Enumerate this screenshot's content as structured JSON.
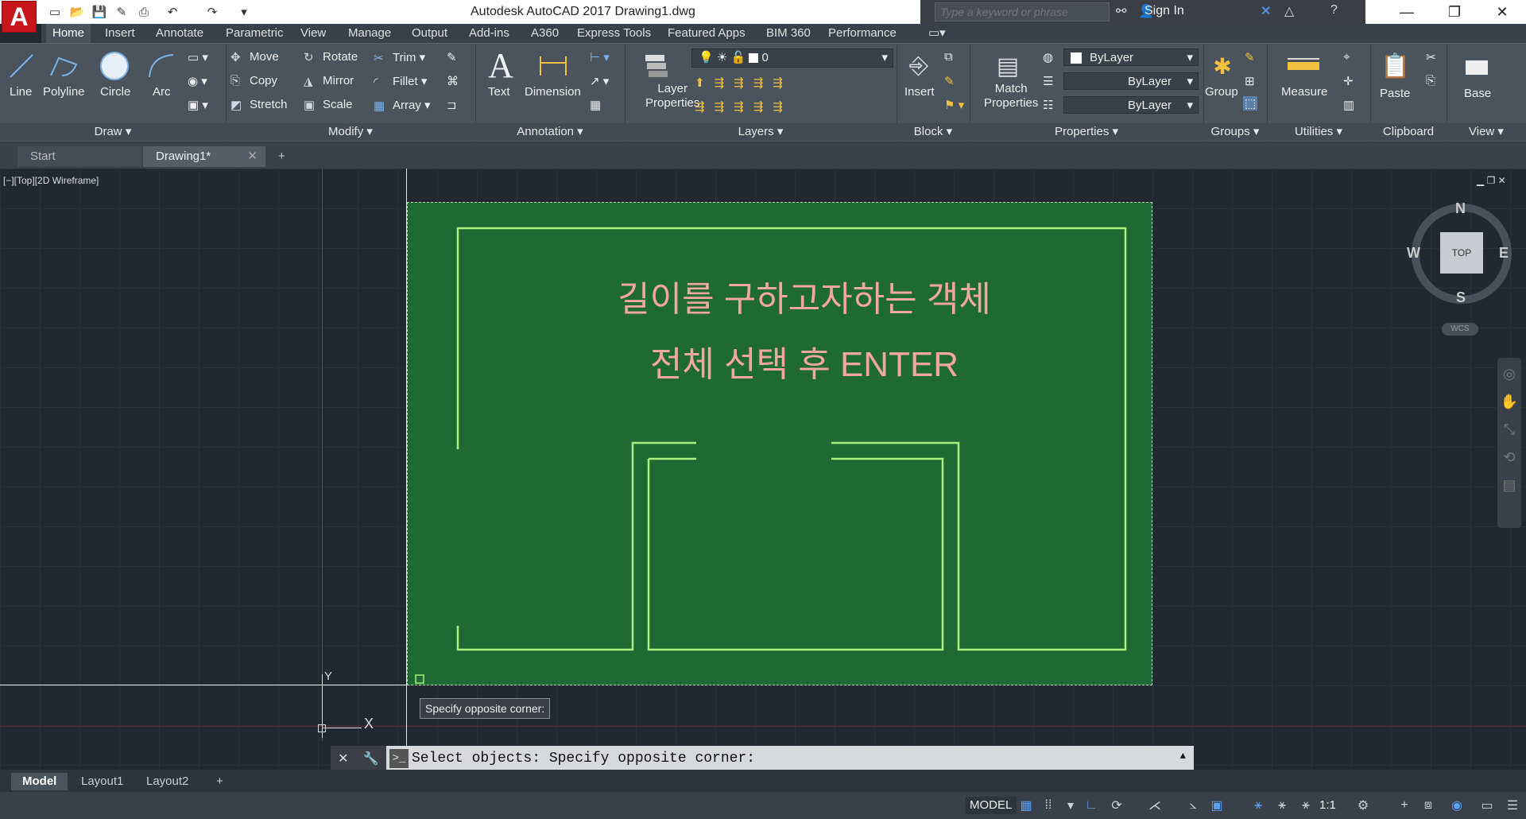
{
  "app": {
    "logo": "A",
    "title": "Autodesk AutoCAD 2017    Drawing1.dwg",
    "search_placeholder": "Type a keyword or phrase",
    "sign_in": "Sign In"
  },
  "quick_access": [
    "new-icon",
    "open-icon",
    "save-icon",
    "save-as-icon",
    "plot-icon",
    "undo-icon",
    "redo-icon",
    "customize-icon"
  ],
  "ribbon_tabs": [
    "Home",
    "Insert",
    "Annotate",
    "Parametric",
    "View",
    "Manage",
    "Output",
    "Add-ins",
    "A360",
    "Express Tools",
    "Featured Apps",
    "BIM 360",
    "Performance"
  ],
  "active_tab": "Home",
  "panels": {
    "draw": {
      "label": "Draw",
      "tools": [
        "Line",
        "Polyline",
        "Circle",
        "Arc"
      ]
    },
    "modify": {
      "label": "Modify",
      "tools": [
        "Move",
        "Rotate",
        "Trim",
        "Copy",
        "Mirror",
        "Fillet",
        "Stretch",
        "Scale",
        "Array"
      ]
    },
    "annotation": {
      "label": "Annotation",
      "tools": [
        "Text",
        "Dimension"
      ]
    },
    "layers": {
      "label": "Layers",
      "tool": "Layer Properties",
      "current_layer": "0"
    },
    "block": {
      "label": "Block",
      "tool": "Insert"
    },
    "properties": {
      "label": "Properties",
      "tool": "Match Properties",
      "color": "ByLayer",
      "linetype": "ByLayer",
      "lineweight": "ByLayer"
    },
    "groups": {
      "label": "Groups",
      "tool": "Group"
    },
    "utilities": {
      "label": "Utilities",
      "tool": "Measure"
    },
    "clipboard": {
      "label": "Clipboard",
      "tool": "Paste"
    },
    "view": {
      "label": "View",
      "tool": "Base"
    }
  },
  "doc_tabs": [
    "Start",
    "Drawing1*"
  ],
  "viewport": {
    "label": "[−][Top][2D Wireframe]",
    "headline_line1": "길이를 구하고자하는 객체",
    "headline_line2": "전체 선택 후 ENTER",
    "tooltip": "Specify opposite corner:",
    "ucs_x": "X",
    "ucs_y": "Y"
  },
  "viewcube": {
    "north": "N",
    "south": "S",
    "east": "E",
    "west": "W",
    "top": "TOP",
    "wcs": "WCS"
  },
  "command_line": "Select objects: Specify opposite corner:",
  "layout_tabs": [
    "Model",
    "Layout1",
    "Layout2"
  ],
  "status": {
    "mode": "MODEL",
    "scale": "1:1"
  },
  "colors": {
    "selection_fill": "#1e6a32",
    "geometry": "#a8f080",
    "headline": "#f2a6a0"
  }
}
